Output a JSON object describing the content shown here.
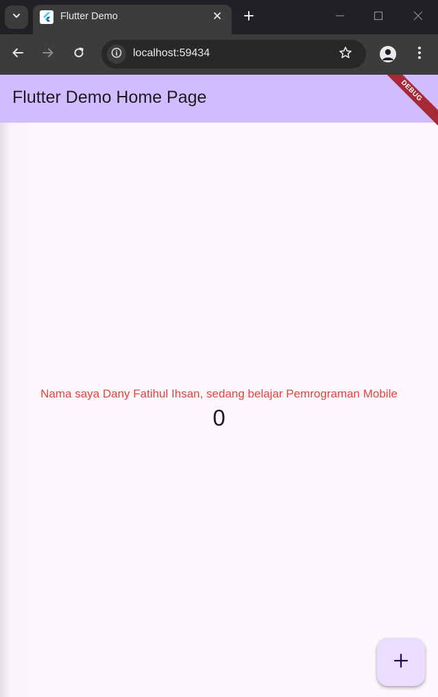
{
  "browser": {
    "tab_title": "Flutter Demo",
    "url": "localhost:59434",
    "colors": {
      "tabstrip": "#202124",
      "toolbar": "#3c3c3c",
      "omnibox": "#282828"
    }
  },
  "app": {
    "appbar_title": "Flutter Demo Home Page",
    "debug_label": "DEBUG",
    "message": "Nama saya Dany Fatihul Ihsan, sedang belajar Pemrograman Mobile",
    "counter": "0",
    "fab_icon": "plus-icon",
    "colors": {
      "appbar": "#d0bcfe",
      "background": "#fef7fe",
      "message": "#e0453b",
      "fab": "#eaddff",
      "debug_banner": "#a52a36"
    }
  },
  "icons": {
    "tab_search": "chevron-down-icon",
    "favicon": "flutter-logo-icon",
    "tab_close": "close-icon",
    "new_tab": "plus-icon",
    "minimize": "minimize-icon",
    "maximize": "maximize-icon",
    "close_window": "close-icon",
    "back": "arrow-left-icon",
    "forward": "arrow-right-icon",
    "reload": "reload-icon",
    "site_info": "info-icon",
    "bookmark": "star-icon",
    "profile": "person-icon",
    "menu": "kebab-menu-icon"
  }
}
